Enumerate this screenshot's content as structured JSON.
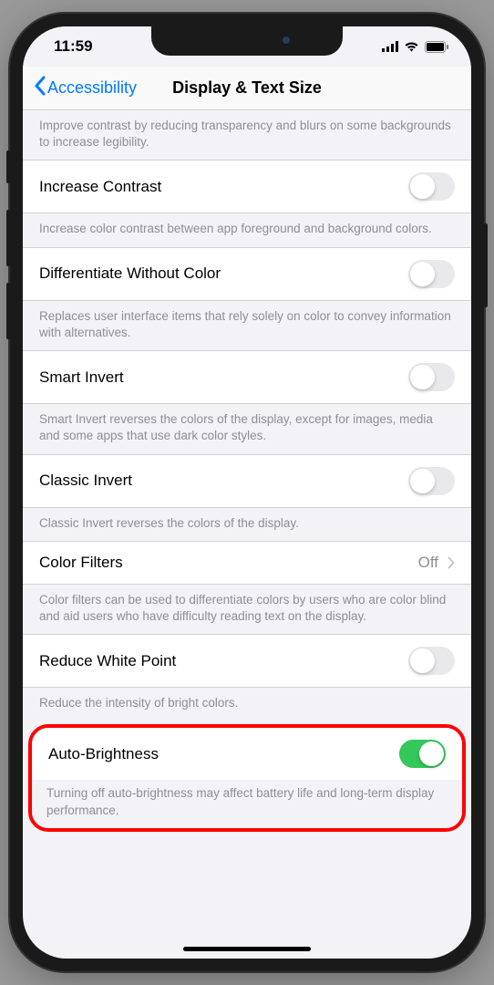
{
  "status": {
    "time": "11:59"
  },
  "nav": {
    "back_label": "Accessibility",
    "title": "Display & Text Size"
  },
  "rows": {
    "transparency_footer": "Improve contrast by reducing transparency and blurs on some backgrounds to increase legibility.",
    "increase_contrast": "Increase Contrast",
    "increase_contrast_footer": "Increase color contrast between app foreground and background colors.",
    "diff_without_color": "Differentiate Without Color",
    "diff_without_color_footer": "Replaces user interface items that rely solely on color to convey information with alternatives.",
    "smart_invert": "Smart Invert",
    "smart_invert_footer": "Smart Invert reverses the colors of the display, except for images, media and some apps that use dark color styles.",
    "classic_invert": "Classic Invert",
    "classic_invert_footer": "Classic Invert reverses the colors of the display.",
    "color_filters": "Color Filters",
    "color_filters_value": "Off",
    "color_filters_footer": "Color filters can be used to differentiate colors by users who are color blind and aid users who have difficulty reading text on the display.",
    "reduce_white_point": "Reduce White Point",
    "reduce_white_point_footer": "Reduce the intensity of bright colors.",
    "auto_brightness": "Auto-Brightness",
    "auto_brightness_footer": "Turning off auto-brightness may affect battery life and long-term display performance."
  },
  "toggles": {
    "increase_contrast": false,
    "diff_without_color": false,
    "smart_invert": false,
    "classic_invert": false,
    "reduce_white_point": false,
    "auto_brightness": true
  }
}
